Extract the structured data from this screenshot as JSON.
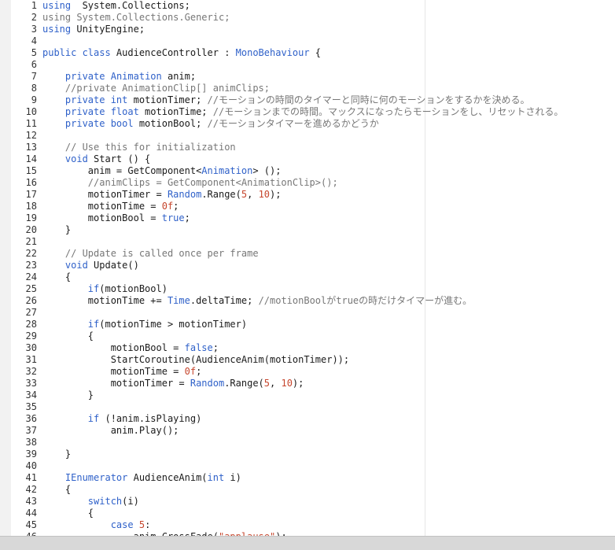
{
  "colors": {
    "keyword": "#2f61c9",
    "comment": "#777777",
    "literal": "#c6462d",
    "text": "#1a1a1a",
    "line_number": "#333333"
  },
  "lines": [
    {
      "n": "1",
      "t": [
        [
          "kw",
          "using"
        ],
        [
          "",
          "  System.Collections;"
        ]
      ]
    },
    {
      "n": "2",
      "t": [
        [
          "cm",
          "using System.Collections.Generic;"
        ]
      ]
    },
    {
      "n": "3",
      "t": [
        [
          "kw",
          "using"
        ],
        [
          "",
          " UnityEngine;"
        ]
      ]
    },
    {
      "n": "4",
      "t": []
    },
    {
      "n": "5",
      "t": [
        [
          "kw",
          "public class"
        ],
        [
          "",
          " AudienceController : "
        ],
        [
          "ty",
          "MonoBehaviour"
        ],
        [
          "",
          " {"
        ]
      ]
    },
    {
      "n": "6",
      "t": []
    },
    {
      "n": "7",
      "t": [
        [
          "",
          "    "
        ],
        [
          "kw",
          "private"
        ],
        [
          "",
          " "
        ],
        [
          "ty",
          "Animation"
        ],
        [
          "",
          " anim;"
        ]
      ]
    },
    {
      "n": "8",
      "t": [
        [
          "",
          "    "
        ],
        [
          "cm",
          "//private AnimationClip[] animClips;"
        ]
      ]
    },
    {
      "n": "9",
      "t": [
        [
          "",
          "    "
        ],
        [
          "kw",
          "private int"
        ],
        [
          "",
          " motionTimer; "
        ],
        [
          "cm",
          "//モーションの時間のタイマーと同時に何のモーションをするかを決める。"
        ]
      ]
    },
    {
      "n": "10",
      "t": [
        [
          "",
          "    "
        ],
        [
          "kw",
          "private float"
        ],
        [
          "",
          " motionTime; "
        ],
        [
          "cm",
          "//モーションまでの時間。マックスになったらモーションをし、リセットされる。"
        ]
      ]
    },
    {
      "n": "11",
      "t": [
        [
          "",
          "    "
        ],
        [
          "kw",
          "private bool"
        ],
        [
          "",
          " motionBool; "
        ],
        [
          "cm",
          "//モーションタイマーを進めるかどうか"
        ]
      ]
    },
    {
      "n": "12",
      "t": []
    },
    {
      "n": "13",
      "t": [
        [
          "",
          "    "
        ],
        [
          "cm",
          "// Use this for initialization"
        ]
      ]
    },
    {
      "n": "14",
      "t": [
        [
          "",
          "    "
        ],
        [
          "kw",
          "void"
        ],
        [
          "",
          " Start () {"
        ]
      ]
    },
    {
      "n": "15",
      "t": [
        [
          "",
          "        anim = GetComponent<"
        ],
        [
          "ty",
          "Animation"
        ],
        [
          "",
          "> ();"
        ]
      ]
    },
    {
      "n": "16",
      "t": [
        [
          "",
          "        "
        ],
        [
          "cm",
          "//animClips = GetComponent<AnimationClip>();"
        ]
      ]
    },
    {
      "n": "17",
      "t": [
        [
          "",
          "        motionTimer = "
        ],
        [
          "ty",
          "Random"
        ],
        [
          "",
          ".Range("
        ],
        [
          "lit",
          "5"
        ],
        [
          "",
          ", "
        ],
        [
          "lit",
          "10"
        ],
        [
          "",
          ");"
        ]
      ]
    },
    {
      "n": "18",
      "t": [
        [
          "",
          "        motionTime = "
        ],
        [
          "lit",
          "0f"
        ],
        [
          "",
          ";"
        ]
      ]
    },
    {
      "n": "19",
      "t": [
        [
          "",
          "        motionBool = "
        ],
        [
          "kw",
          "true"
        ],
        [
          "",
          ";"
        ]
      ]
    },
    {
      "n": "20",
      "t": [
        [
          "",
          "    }"
        ]
      ]
    },
    {
      "n": "21",
      "t": []
    },
    {
      "n": "22",
      "t": [
        [
          "",
          "    "
        ],
        [
          "cm",
          "// Update is called once per frame"
        ]
      ]
    },
    {
      "n": "23",
      "t": [
        [
          "",
          "    "
        ],
        [
          "kw",
          "void"
        ],
        [
          "",
          " Update()"
        ]
      ]
    },
    {
      "n": "24",
      "t": [
        [
          "",
          "    {"
        ]
      ]
    },
    {
      "n": "25",
      "t": [
        [
          "",
          "        "
        ],
        [
          "kw",
          "if"
        ],
        [
          "",
          "(motionBool)"
        ]
      ]
    },
    {
      "n": "26",
      "t": [
        [
          "",
          "        motionTime += "
        ],
        [
          "ty",
          "Time"
        ],
        [
          "",
          ".deltaTime; "
        ],
        [
          "cm",
          "//motionBoolがtrueの時だけタイマーが進む。"
        ]
      ]
    },
    {
      "n": "27",
      "t": []
    },
    {
      "n": "28",
      "t": [
        [
          "",
          "        "
        ],
        [
          "kw",
          "if"
        ],
        [
          "",
          "(motionTime > motionTimer)"
        ]
      ]
    },
    {
      "n": "29",
      "t": [
        [
          "",
          "        {"
        ]
      ]
    },
    {
      "n": "30",
      "t": [
        [
          "",
          "            motionBool = "
        ],
        [
          "kw",
          "false"
        ],
        [
          "",
          ";"
        ]
      ]
    },
    {
      "n": "31",
      "t": [
        [
          "",
          "            StartCoroutine(AudienceAnim(motionTimer));"
        ]
      ]
    },
    {
      "n": "32",
      "t": [
        [
          "",
          "            motionTime = "
        ],
        [
          "lit",
          "0f"
        ],
        [
          "",
          ";"
        ]
      ]
    },
    {
      "n": "33",
      "t": [
        [
          "",
          "            motionTimer = "
        ],
        [
          "ty",
          "Random"
        ],
        [
          "",
          ".Range("
        ],
        [
          "lit",
          "5"
        ],
        [
          "",
          ", "
        ],
        [
          "lit",
          "10"
        ],
        [
          "",
          ");"
        ]
      ]
    },
    {
      "n": "34",
      "t": [
        [
          "",
          "        }"
        ]
      ]
    },
    {
      "n": "35",
      "t": []
    },
    {
      "n": "36",
      "t": [
        [
          "",
          "        "
        ],
        [
          "kw",
          "if"
        ],
        [
          "",
          " (!anim.isPlaying)"
        ]
      ]
    },
    {
      "n": "37",
      "t": [
        [
          "",
          "            anim.Play();"
        ]
      ]
    },
    {
      "n": "38",
      "t": []
    },
    {
      "n": "39",
      "t": [
        [
          "",
          "    }"
        ]
      ]
    },
    {
      "n": "40",
      "t": []
    },
    {
      "n": "41",
      "t": [
        [
          "",
          "    "
        ],
        [
          "ty",
          "IEnumerator"
        ],
        [
          "",
          " AudienceAnim("
        ],
        [
          "kw",
          "int"
        ],
        [
          "",
          " i)"
        ]
      ]
    },
    {
      "n": "42",
      "t": [
        [
          "",
          "    {"
        ]
      ]
    },
    {
      "n": "43",
      "t": [
        [
          "",
          "        "
        ],
        [
          "kw",
          "switch"
        ],
        [
          "",
          "(i)"
        ]
      ]
    },
    {
      "n": "44",
      "t": [
        [
          "",
          "        {"
        ]
      ]
    },
    {
      "n": "45",
      "t": [
        [
          "",
          "            "
        ],
        [
          "kw",
          "case"
        ],
        [
          "",
          " "
        ],
        [
          "lit",
          "5"
        ],
        [
          "",
          ":"
        ]
      ]
    },
    {
      "n": "46",
      "t": [
        [
          "",
          "                anim.CrossFade("
        ],
        [
          "str",
          "\"applause\""
        ],
        [
          "",
          ");"
        ]
      ]
    }
  ]
}
